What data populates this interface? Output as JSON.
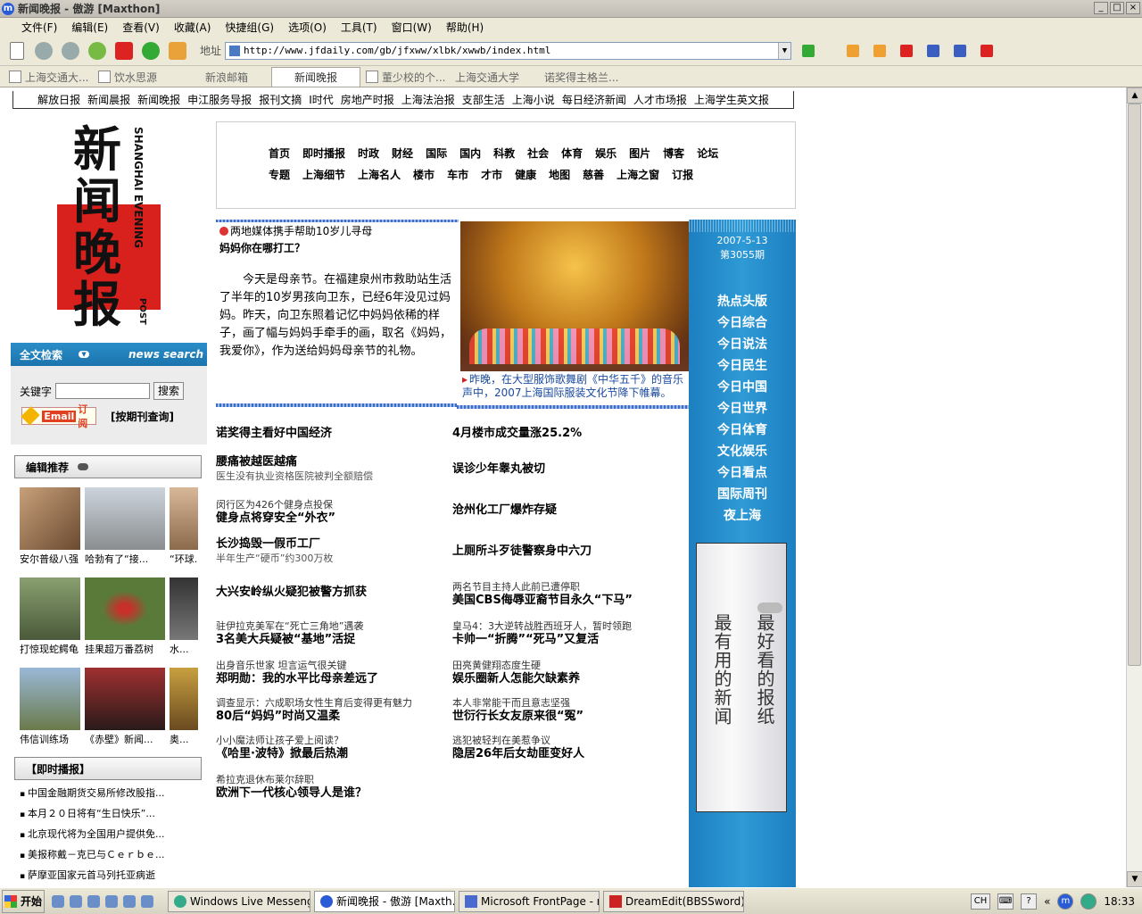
{
  "window": {
    "title": "新闻晚报 - 傲游 [Maxthon]"
  },
  "menu": [
    "文件(F)",
    "编辑(E)",
    "查看(V)",
    "收藏(A)",
    "快捷组(G)",
    "选项(O)",
    "工具(T)",
    "窗口(W)",
    "帮助(H)"
  ],
  "address": {
    "label": "地址",
    "url": "http://www.jfdaily.com/gb/jfxww/xlbk/xwwb/index.html"
  },
  "tabs": [
    "上海交通大...",
    "饮水思源",
    "新浪邮箱",
    "新闻晚报",
    "董少校的个...",
    "上海交通大学",
    "诺奖得主格兰..."
  ],
  "topnav": [
    "解放日报",
    "新闻晨报",
    "新闻晚报",
    "申江服务导报",
    "报刊文摘",
    "I时代",
    "房地产时报",
    "上海法治报",
    "支部生活",
    "上海小说",
    "每日经济新闻",
    "人才市场报",
    "上海学生英文报"
  ],
  "logo": {
    "chars": "新闻晚报",
    "en": "SHANGHAI EVENING",
    "post": "POST"
  },
  "search": {
    "title": "全文检索",
    "en": "news search",
    "keyword_label": "关键字",
    "button": "搜索",
    "email_e": "Email",
    "email_s": "订阅",
    "archive": "[按期刊查询]"
  },
  "editor_pick": {
    "title": "编辑推荐",
    "photos": [
      {
        "cap": "安尔普级八强"
      },
      {
        "cap": "哈勃有了“接..."
      },
      {
        "cap": "“环球..."
      },
      {
        "cap": "打惊现蛇鳄龟"
      },
      {
        "cap": "挂果超万番荔树"
      },
      {
        "cap": "水..."
      },
      {
        "cap": "伟信训练场"
      },
      {
        "cap": "《赤壁》新闻..."
      },
      {
        "cap": "奥..."
      }
    ]
  },
  "instant": {
    "title": "【即时播报】",
    "items": [
      "中国金融期货交易所修改股指...",
      "本月２０日将有“生日快乐”...",
      "北京现代将为全国用户提供免...",
      "美报称戴－克已与Ｃｅｒｂｅ...",
      "萨摩亚国家元首马列托亚病逝"
    ]
  },
  "categories": {
    "row1": [
      "首页",
      "即时播报",
      "时政",
      "财经",
      "国际",
      "国内",
      "科教",
      "社会",
      "体育",
      "娱乐",
      "图片",
      "博客",
      "论坛"
    ],
    "row2": [
      "专题",
      "上海细节",
      "上海名人",
      "楼市",
      "车市",
      "才市",
      "健康",
      "地图",
      "慈善",
      "上海之窗",
      "订报"
    ]
  },
  "feature": {
    "tag": "两地媒体携手帮助10岁儿寻母",
    "title": "妈妈你在哪打工？",
    "body": "今天是母亲节。在福建泉州市救助站生活了半年的10岁男孩向卫东，已经6年没见过妈妈。昨天，向卫东照着记忆中妈妈依稀的样子，画了幅与妈妈手牵手的画，取名《妈妈，我爱你》，作为送给妈妈母亲节的礼物。",
    "photo_caption": "昨晚，在大型服饰歌舞剧《中华五千》的音乐声中，2007上海国际服装文化节降下帷幕。"
  },
  "headlines_left": [
    {
      "sub": "",
      "main": "诺奖得主看好中国经济",
      "gray": ""
    },
    {
      "sub": "",
      "main": "腰痛被越医越痛",
      "gray": "医生没有执业资格医院被判全额赔偿"
    },
    {
      "sub": "闵行区为426个健身点投保",
      "main": "健身点将穿安全“外衣”",
      "gray": ""
    },
    {
      "sub": "",
      "main": "长沙捣毁一假币工厂",
      "gray": "半年生产“硬币”约300万枚"
    },
    {
      "sub": "",
      "main": "大兴安岭纵火疑犯被警方抓获",
      "gray": ""
    },
    {
      "sub": "驻伊拉克美军在“死亡三角地”遇袭",
      "main": "3名美大兵疑被“基地”活捉",
      "gray": ""
    },
    {
      "sub": "出身音乐世家 坦言运气很关键",
      "main": "郑明勋：我的水平比母亲差远了",
      "gray": ""
    },
    {
      "sub": "调查显示：六成职场女性生育后变得更有魅力",
      "main": "80后“妈妈”时尚又温柔",
      "gray": ""
    },
    {
      "sub": "小小魔法师让孩子爱上阅读？",
      "main": "《哈里·波特》掀最后热潮",
      "gray": ""
    },
    {
      "sub": "希拉克退休布莱尔辞职",
      "main": "欧洲下一代核心领导人是谁？",
      "gray": ""
    }
  ],
  "headlines_right": [
    {
      "sub": "",
      "main": "4月楼市成交量涨25.2%"
    },
    {
      "sub": "",
      "main": "误诊少年睾丸被切"
    },
    {
      "sub": "",
      "main": "沧州化工厂爆炸存疑"
    },
    {
      "sub": "",
      "main": "上厕所斗歹徒警察身中六刀"
    },
    {
      "sub": "两名节目主持人此前已遭停职",
      "main": "美国CBS侮辱亚裔节目永久“下马”"
    },
    {
      "sub": "皇马4：3大逆转战胜西班牙人，暂时领跑",
      "main": "卡帅一“折腾”“死马”又复活"
    },
    {
      "sub": "田亮黄健翔态度生硬",
      "main": "娱乐圈新人怎能欠缺素养"
    },
    {
      "sub": "本人非常能干而且意志坚强",
      "main": "世衍行长女友原来很“冤”"
    },
    {
      "sub": "逃犯被轻判在美惹争议",
      "main": "隐居26年后女劫匪变好人"
    }
  ],
  "issue": {
    "date": "2007-5-13",
    "no": "第3055期"
  },
  "sections": [
    "热点头版",
    "今日综合",
    "今日说法",
    "今日民生",
    "今日中国",
    "今日世界",
    "今日体育",
    "文化娱乐",
    "今日看点",
    "国际周刊",
    "夜上海"
  ],
  "promo": {
    "line1": "最好看的报纸",
    "line2": "最有用的新闻"
  },
  "taskbar": {
    "start": "开始",
    "tasks": [
      "Windows Live Messenger",
      "新闻晚报 - 傲游 [Maxth...",
      "Microsoft FrontPage - ne...",
      "DreamEdit(BBSSword)"
    ],
    "lang": "CH",
    "time": "18:33"
  },
  "colors": {
    "accent": "#1d7fc0",
    "logo_red": "#d8201c",
    "link_blue": "#1a4aa0"
  }
}
